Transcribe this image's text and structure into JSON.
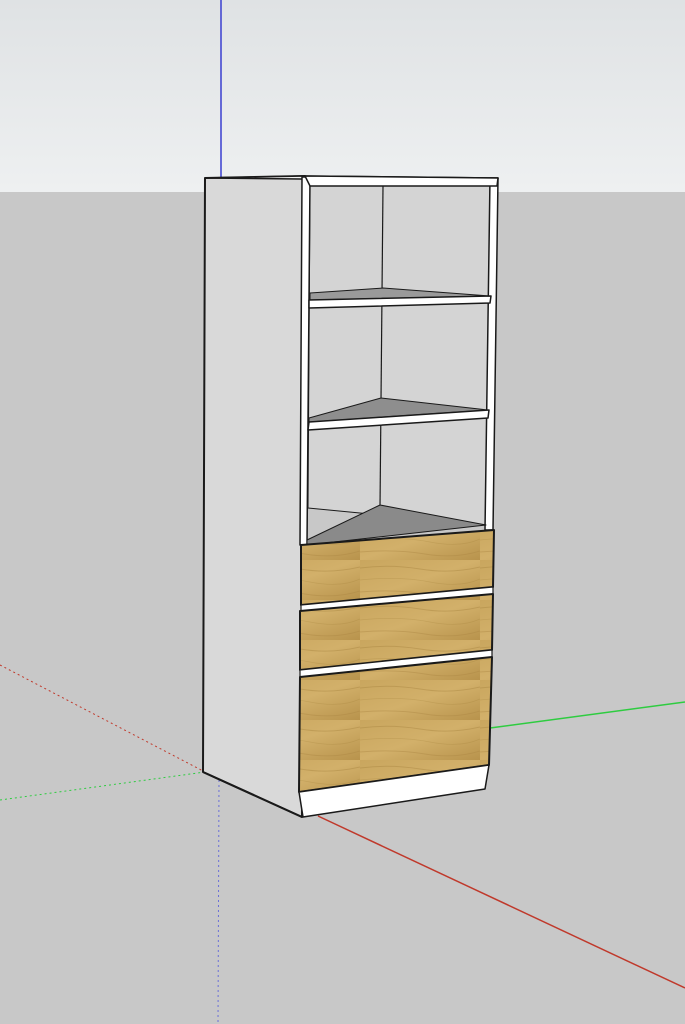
{
  "colors": {
    "sky_top": "#dfe2e4",
    "sky_bottom": "#eef0f1",
    "ground": "#c8c8c8",
    "axis_red": "#c0392b",
    "axis_green": "#2ecc40",
    "axis_blue": "#3a3fd0",
    "panel_white": "#ffffff",
    "side_panel": "#d9d9d9",
    "back_panel": "#d4d4d4",
    "interior_shadow": "#8a8a8a",
    "oak": "#c8a45c",
    "oak_dark": "#a98540",
    "edge": "#1a1a1a"
  },
  "model": {
    "type": "tall-cabinet",
    "open_shelf_count": 3,
    "drawer_count": 3,
    "drawer_finish": "oak"
  }
}
